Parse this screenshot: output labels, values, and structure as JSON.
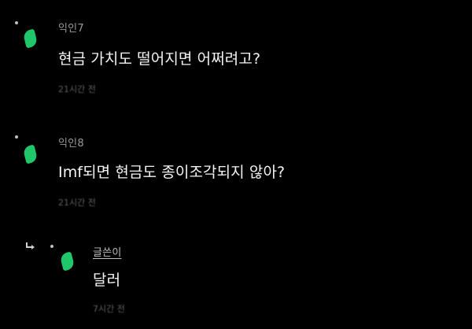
{
  "colors": {
    "background": "#000000",
    "leaf_green": "#1fc76a",
    "text_primary": "#f4f4f4",
    "text_author": "#9a9a9a",
    "text_time": "#5f5f5f"
  },
  "comments": [
    {
      "author": "익인7",
      "text": "현금 가치도 떨어지면 어쩌려고?",
      "time": "21시간 전",
      "avatar_icon": "green-leaf-icon"
    },
    {
      "author": "익인8",
      "text": "Imf되면 현금도 종이조각되지 않아?",
      "time": "21시간 전",
      "avatar_icon": "green-leaf-icon"
    }
  ],
  "reply": {
    "author": "글쓴이",
    "text": "달러",
    "time": "7시간 전",
    "avatar_icon": "green-leaf-icon",
    "reply_icon": "reply-arrow-icon"
  }
}
